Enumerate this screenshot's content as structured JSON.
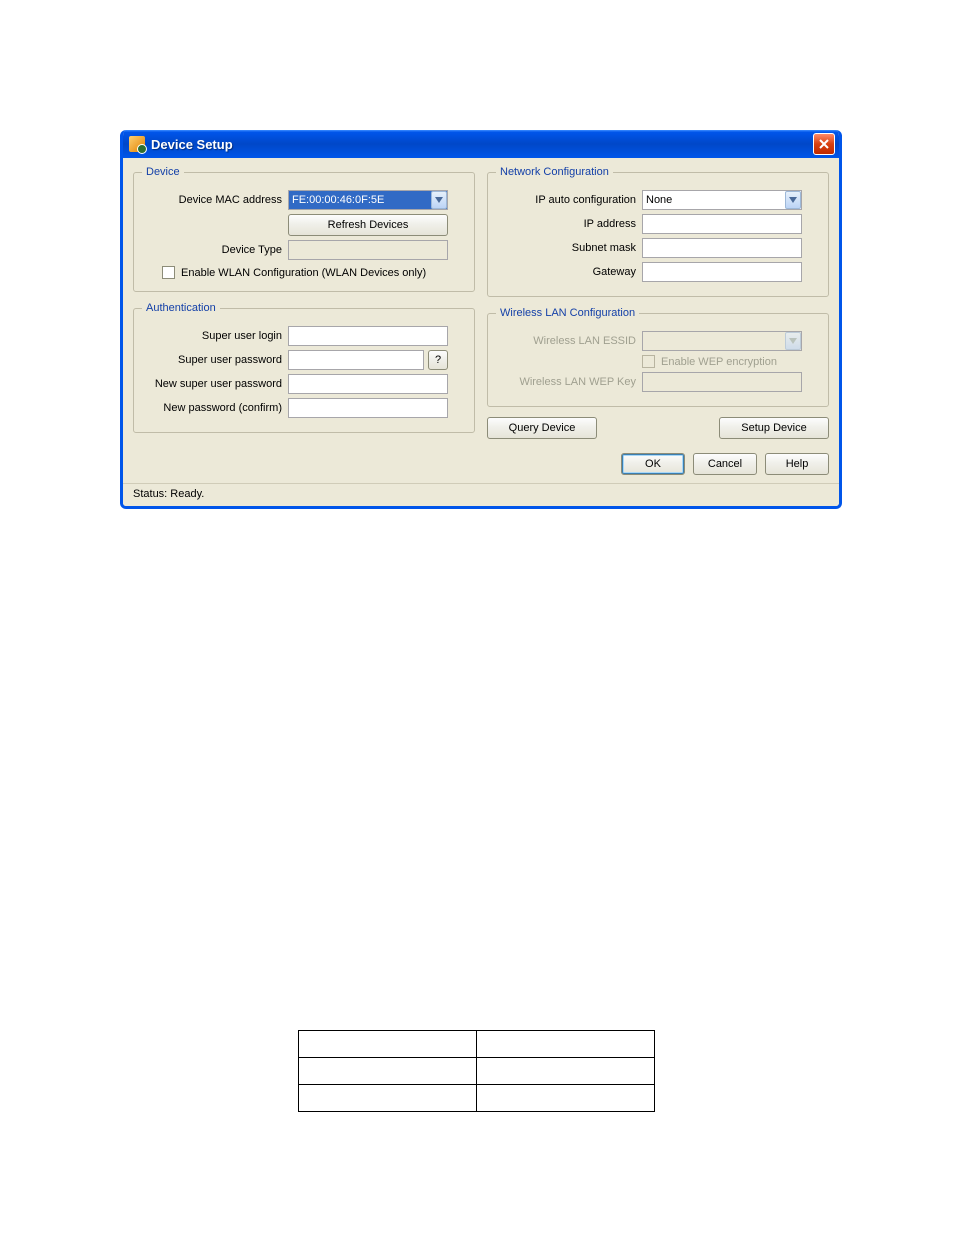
{
  "window": {
    "title": "Device Setup"
  },
  "device": {
    "legend": "Device",
    "mac_label": "Device MAC address",
    "mac_value": "FE:00:00:46:0F:5E",
    "refresh_label": "Refresh Devices",
    "type_label": "Device Type",
    "type_value": "",
    "wlan_checkbox_label": "Enable WLAN Configuration (WLAN Devices only)"
  },
  "network": {
    "legend": "Network Configuration",
    "ipauto_label": "IP auto configuration",
    "ipauto_value": "None",
    "ipaddr_label": "IP address",
    "ipaddr_value": "",
    "subnet_label": "Subnet mask",
    "subnet_value": "",
    "gateway_label": "Gateway",
    "gateway_value": ""
  },
  "auth": {
    "legend": "Authentication",
    "su_login_label": "Super user login",
    "su_login_value": "",
    "su_pw_label": "Super user password",
    "su_pw_value": "",
    "help_btn": "?",
    "new_pw_label": "New super user password",
    "new_pw_value": "",
    "confirm_label": "New password (confirm)",
    "confirm_value": ""
  },
  "wlan": {
    "legend": "Wireless LAN Configuration",
    "essid_label": "Wireless LAN ESSID",
    "essid_value": "",
    "wep_checkbox_label": "Enable WEP encryption",
    "wepkey_label": "Wireless LAN WEP Key",
    "wepkey_value": ""
  },
  "actions": {
    "query_label": "Query Device",
    "setup_label": "Setup Device"
  },
  "footer": {
    "ok": "OK",
    "cancel": "Cancel",
    "help": "Help"
  },
  "status": {
    "text": "Status: Ready."
  }
}
